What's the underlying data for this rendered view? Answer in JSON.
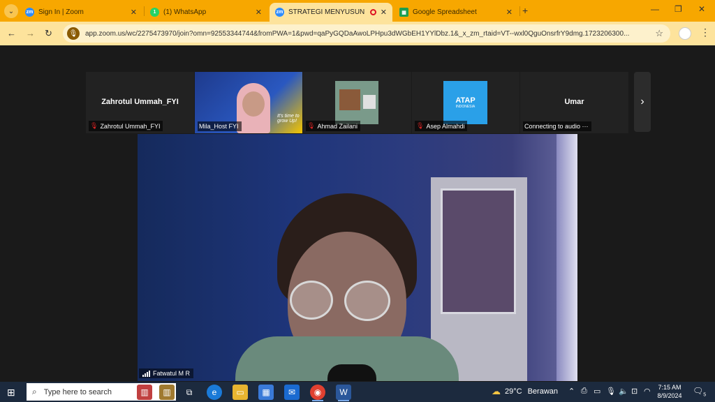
{
  "browser": {
    "tabs": [
      {
        "title": "Sign In | Zoom",
        "favicon": "zoom-icon",
        "active": false
      },
      {
        "title": "(1) WhatsApp",
        "favicon": "whatsapp-icon",
        "active": false
      },
      {
        "title": "STRATEGI MENYUSUN KON",
        "favicon": "zoom-icon",
        "active": true,
        "recording": true
      },
      {
        "title": "Google Spreadsheet",
        "favicon": "sheets-icon",
        "active": false
      }
    ],
    "url": "app.zoom.us/wc/2275473970/join?omn=92553344744&fromPWA=1&pwd=qaPyGQDaAwoLPHpu3dWGbEH1YYlDbz.1&_x_zm_rtaid=VT--wxl0QguOnsrfrY9dmg.1723206300..."
  },
  "zoom": {
    "tiles": [
      {
        "big_name": "Zahrotul Ummah_FYI",
        "label": "Zahrotul Ummah_FYI",
        "muted": true
      },
      {
        "big_name": "",
        "label": "Mila_Host FYI",
        "muted": false
      },
      {
        "big_name": "",
        "label": "Ahmad Zailani",
        "muted": true
      },
      {
        "big_name": "",
        "label": "Asep Almahdi",
        "muted": true
      },
      {
        "big_name": "Umar",
        "label": "Connecting to audio ···",
        "muted": false
      }
    ],
    "main_speaker": "Fatwatul M R",
    "tile_text": {
      "banner": "It's time to grow Up!",
      "logo_text": "ATAP",
      "logo_sub": "INDONESIA"
    }
  },
  "taskbar": {
    "search_placeholder": "Type here to search",
    "weather": {
      "temp": "29°C",
      "condition": "Berawan"
    },
    "time": "7:15 AM",
    "date": "8/9/2024",
    "notifications": "5"
  }
}
